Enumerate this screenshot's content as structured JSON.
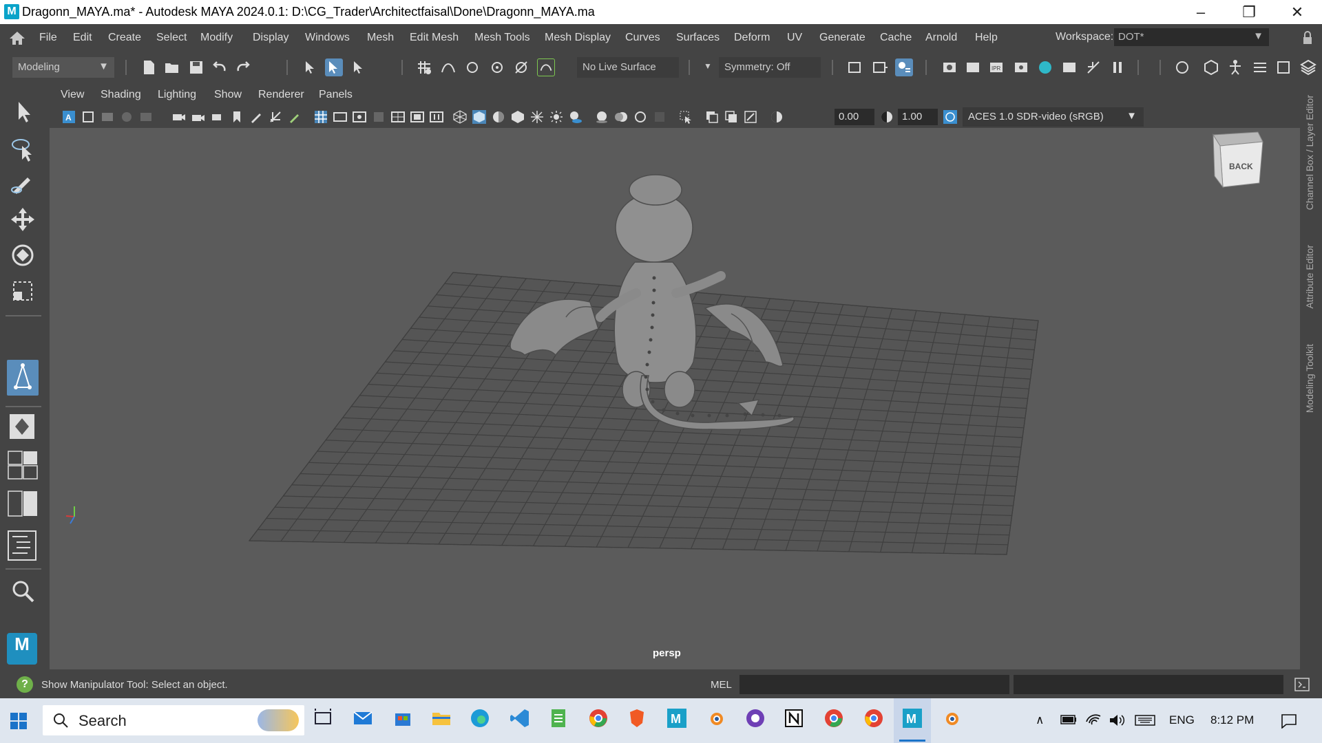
{
  "window": {
    "app_logo": "M",
    "title": "Dragonn_MAYA.ma* - Autodesk MAYA 2024.0.1: D:\\CG_Trader\\Architectfaisal\\Done\\Dragonn_MAYA.ma",
    "controls": [
      "minimize-icon",
      "restore-icon",
      "close-icon"
    ]
  },
  "menubar": {
    "items": [
      "File",
      "Edit",
      "Create",
      "Select",
      "Modify",
      "Display",
      "Windows",
      "Mesh",
      "Edit Mesh",
      "Mesh Tools",
      "Mesh Display",
      "Curves",
      "Surfaces",
      "Deform",
      "UV",
      "Generate",
      "Cache",
      "Arnold",
      "Help"
    ],
    "workspace_label": "Workspace:",
    "workspace_value": "DOT*"
  },
  "toolbar": {
    "mode": "Modeling",
    "live_surface": "No Live Surface",
    "symmetry": "Symmetry: Off"
  },
  "panel": {
    "menu": [
      "View",
      "Shading",
      "Lighting",
      "Show",
      "Renderer",
      "Panels"
    ],
    "exposure": "0.00",
    "gamma": "1.00",
    "color_management": "ACES 1.0 SDR-video (sRGB)",
    "camera": "persp",
    "view_cube_label": "BACK"
  },
  "side_tabs": [
    "Channel Box / Layer Editor",
    "Attribute Editor",
    "Modeling Toolkit"
  ],
  "status": {
    "help_text": "Show Manipulator Tool: Select an object.",
    "command_language": "MEL"
  },
  "taskbar": {
    "search_placeholder": "Search",
    "language": "ENG",
    "time": "8:12 PM"
  },
  "colors": {
    "ui_bg": "#444444",
    "viewport_bg": "#5b5b5b",
    "active_tool": "#5a8dbb",
    "taskbar_bg": "#dfe6ef"
  }
}
